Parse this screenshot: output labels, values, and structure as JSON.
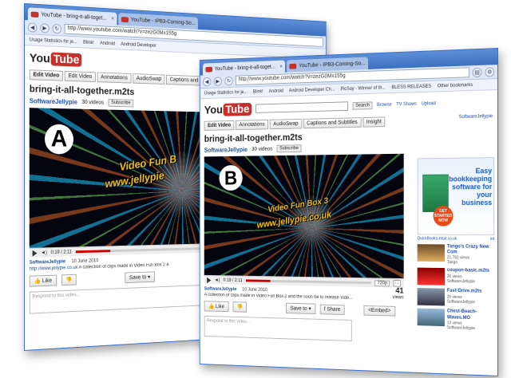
{
  "colors": {
    "brand_red": "#c4302b",
    "link_blue": "#1a4fa0",
    "chrome_blue": "#3c6fc0"
  },
  "windowA": {
    "tabs": [
      {
        "label": "YouTube - bring-it-all-toget..."
      },
      {
        "label": "YouTube - IPB3-Coming-So..."
      }
    ],
    "url": "http://www.youtube.com/watch?v=zezG0Mx155g",
    "bookmarks": [
      "Usage Statistics for je...",
      "Blink!",
      "Android",
      "Android Developer"
    ],
    "toolbar": [
      "Edit Video",
      "Edit Video",
      "Annotations",
      "AudioSwap",
      "Captions and"
    ],
    "title": "bring-it-all-together.m2ts",
    "channel": "SoftwareJellypie",
    "videos": "30 videos",
    "subscribe": "Subscribe",
    "marker": "A",
    "overlay1": "Video Fun B",
    "overlay2": "www.jellypie",
    "time": "0:19 / 2:11",
    "progress": 0.15,
    "meta_channel": "SoftwareJellypie",
    "meta_date": "10 June 2010",
    "desc_link": "http://www.jellypie.co.uk",
    "desc_text": "A collection of clips made in Video Fun Box 2 a",
    "like": "Like",
    "save": "Save to",
    "respond": "Respond to this video..."
  },
  "windowB": {
    "tabs": [
      {
        "label": "YouTube - bring-it-all-toget..."
      },
      {
        "label": "YouTube - IPB3-Coming-So..."
      }
    ],
    "url": "http://www.youtube.com/watch?v=zezG0Mx155g",
    "bookmarks": [
      "Usage Statistics for je...",
      "Blink!",
      "Android",
      "Android Developer Ch...",
      "PicSay - Winner of th...",
      "BLESS RELEASES",
      "Other bookmarks"
    ],
    "search_btn": "Search",
    "toplinks": [
      "Browse",
      "TV Shows",
      "Upload"
    ],
    "toolbar": [
      "Edit Video",
      "Annotations",
      "AudioSwap",
      "Captions and Subtitles",
      "Insight"
    ],
    "account": "SoftwareJellypie",
    "title": "bring-it-all-together.m2ts",
    "channel": "SoftwareJellypie",
    "videos": "30 videos",
    "subscribe": "Subscribe",
    "marker": "B",
    "overlay1": "Video Fun Box 3",
    "overlay2": "www.jellypie.co.uk",
    "time": "0:19 / 2:11",
    "quality": "720p",
    "progress": 0.2,
    "meta_channel": "SoftwareJellypie",
    "meta_date": "10 June 2010",
    "desc_text": "A collection of clips made in Video Fun Box 2 and the soon be to release Vide...",
    "views_count": "41",
    "views_label": "views",
    "like": "Like",
    "save": "Save to",
    "share": "Share",
    "embed": "<Embed>",
    "respond": "Respond to this video...",
    "ad": {
      "headline": "Easy bookkeeping software for your business",
      "cta": "GET STARTED NOW",
      "foot_left": "QuickBooks.intuit.co.uk",
      "foot_right": "int"
    },
    "related": [
      {
        "title": "Tango's Crazy New Com",
        "views": "21,792 views",
        "by": "Tango"
      },
      {
        "title": "coupon-basic.m2ts",
        "views": "26 views",
        "by": "SoftwareJellypie"
      },
      {
        "title": "Fast-Drive.m2ts",
        "views": "25 views",
        "by": "SoftwareJellypie"
      },
      {
        "title": "Chest-Beach-Waves.MO",
        "views": "13 views",
        "by": "SoftwareJellypie"
      }
    ]
  }
}
